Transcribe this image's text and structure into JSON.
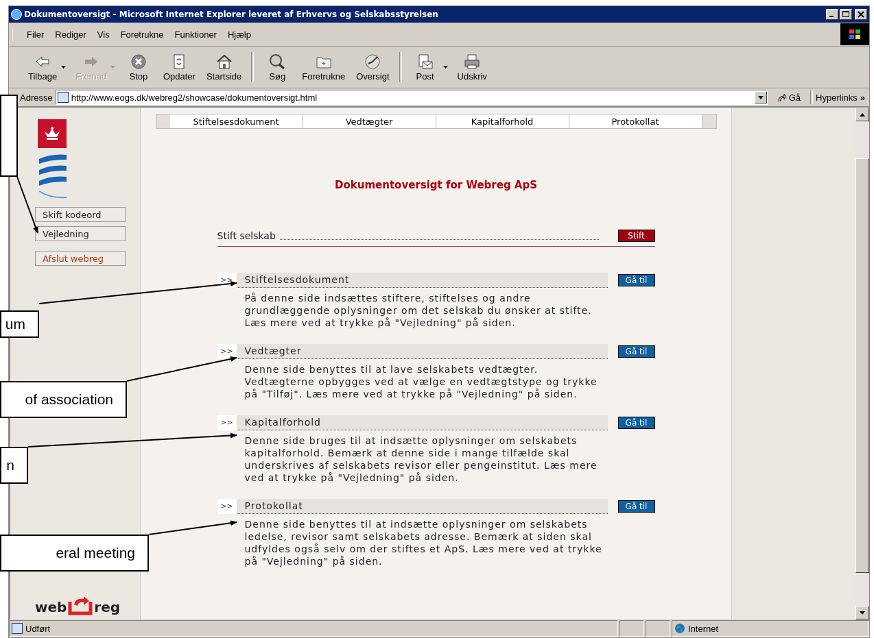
{
  "window": {
    "title": "Dokumentoversigt - Microsoft Internet Explorer leveret af Erhvervs og Selskabsstyrelsen"
  },
  "menu": [
    "Filer",
    "Rediger",
    "Vis",
    "Foretrukne",
    "Funktioner",
    "Hjælp"
  ],
  "toolbar": [
    {
      "label": "Tilbage",
      "disabled": false,
      "dropdown": true,
      "group_start": false
    },
    {
      "label": "Fremad",
      "disabled": true,
      "dropdown": true,
      "group_start": false
    },
    {
      "label": "Stop",
      "disabled": false,
      "dropdown": false,
      "group_start": false
    },
    {
      "label": "Opdater",
      "disabled": false,
      "dropdown": false,
      "group_start": false
    },
    {
      "label": "Startside",
      "disabled": false,
      "dropdown": false,
      "group_start": false
    },
    {
      "label": "Søg",
      "disabled": false,
      "dropdown": false,
      "group_start": true
    },
    {
      "label": "Foretrukne",
      "disabled": false,
      "dropdown": false,
      "group_start": false
    },
    {
      "label": "Oversigt",
      "disabled": false,
      "dropdown": false,
      "group_start": false
    },
    {
      "label": "Post",
      "disabled": false,
      "dropdown": true,
      "group_start": true
    },
    {
      "label": "Udskriv",
      "disabled": false,
      "dropdown": false,
      "group_start": false
    }
  ],
  "address": {
    "label": "Adresse",
    "url": "http://www.eogs.dk/webreg2/showcase/dokumentoversigt.html",
    "go": "Gå",
    "links": "Hyperlinks",
    "more": "»"
  },
  "sidebar": {
    "buttons": [
      {
        "label": "Skift kodeord",
        "kind": "normal"
      },
      {
        "label": "Vejledning",
        "kind": "normal"
      },
      {
        "label": "Afslut webreg",
        "kind": "exit"
      }
    ],
    "logo": {
      "left": "web",
      "right": "reg"
    }
  },
  "tabs": [
    "Stiftelsesdokument",
    "Vedtægter",
    "Kapitalforhold",
    "Protokollat"
  ],
  "heading": "Dokumentoversigt for Webreg ApS",
  "found": {
    "label": "Stift selskab",
    "button": "Stift"
  },
  "sections": [
    {
      "marker": ">>",
      "title": "Stiftelsesdokument",
      "button": "Gå til",
      "text": "På denne side indsættes stiftere, stiftelses og andre grundlæggende oplysninger om det selskab du ønsker at stifte. Læs mere ved at trykke på \"Vejledning\" på siden."
    },
    {
      "marker": ">>",
      "title": "Vedtægter",
      "button": "Gå til",
      "text": "Denne side benyttes til at lave selskabets vedtægter. Vedtægterne opbygges ved at vælge en vedtægtstype og trykke på \"Tilføj\". Læs mere ved at trykke på \"Vejledning\" på siden."
    },
    {
      "marker": ">>",
      "title": "Kapitalforhold",
      "button": "Gå til",
      "text": "Denne side bruges til at indsætte oplysninger om selskabets kapitalforhold. Bemærk at denne side i mange tilfælde skal underskrives af selskabets revisor eller pengeinstitut. Læs mere ved at trykke på \"Vejledning\" på siden."
    },
    {
      "marker": ">>",
      "title": "Protokollat",
      "button": "Gå til",
      "text": "Denne side benyttes til at indsætte oplysninger om selskabets ledelse, revisor samt selskabets adresse. Bemærk at siden skal udfyldes også selv om der stiftes et ApS. Læs mere ved at trykke på \"Vejledning\" på siden."
    }
  ],
  "status": {
    "text": "Udført",
    "zone": "Internet"
  },
  "callouts": [
    {
      "kind": "blank"
    },
    {
      "kind": "text",
      "text": "um"
    },
    {
      "kind": "text",
      "text": "of association"
    },
    {
      "kind": "text",
      "text": "n"
    },
    {
      "kind": "text",
      "text": "eral meeting"
    }
  ]
}
